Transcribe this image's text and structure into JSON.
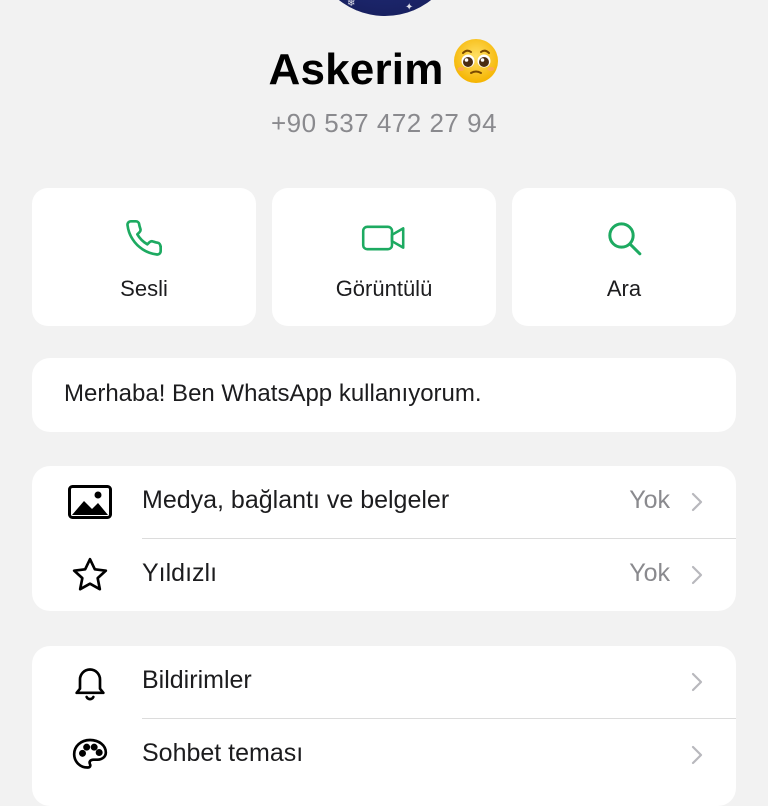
{
  "contact": {
    "name": "Askerim",
    "name_emoji": "🥹",
    "phone": "+90 537 472 27 94"
  },
  "actions": [
    {
      "label": "Sesli",
      "icon": "phone-icon"
    },
    {
      "label": "Görüntülü",
      "icon": "video-icon"
    },
    {
      "label": "Ara",
      "icon": "search-icon"
    }
  ],
  "status": {
    "text": "Merhaba! Ben WhatsApp kullanıyorum."
  },
  "media_section": {
    "items": [
      {
        "label": "Medya, bağlantı ve belgeler",
        "value": "Yok",
        "icon": "image-icon"
      },
      {
        "label": "Yıldızlı",
        "value": "Yok",
        "icon": "star-icon"
      }
    ]
  },
  "settings_section": {
    "items": [
      {
        "label": "Bildirimler",
        "value": "",
        "icon": "bell-icon"
      },
      {
        "label": "Sohbet teması",
        "value": "",
        "icon": "palette-icon"
      }
    ]
  },
  "colors": {
    "accent": "#1daa61",
    "background": "#f2f2f2",
    "card": "#ffffff",
    "secondary_text": "#8a8a8e"
  }
}
